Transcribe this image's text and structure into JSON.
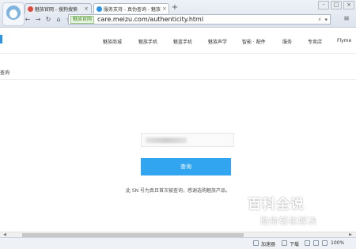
{
  "browser": {
    "tabs": [
      {
        "label": "魅族官网 - 搜狗搜索",
        "icon": "sogou-icon",
        "color": "#e04a3a"
      },
      {
        "label": "服务支持 - 真伪查询 - 魅族",
        "icon": "meizu-icon",
        "color": "#2a93e3"
      }
    ],
    "new_tab": "+",
    "window_buttons": [
      "-",
      "□",
      "×"
    ],
    "nav_buttons": [
      "←",
      "→",
      "↻",
      "⌂",
      "☆"
    ],
    "address": {
      "badge": "魅族官网",
      "url": "care.meizu.com/authenticity.html"
    },
    "address_right": [
      "⚡",
      "▾"
    ],
    "menu": "≡"
  },
  "site_nav": {
    "items": [
      "魅族商城",
      "魅族手机",
      "魅蓝手机",
      "魅族声学",
      "智能 · 配件",
      "服务",
      "专卖店",
      "Flyme"
    ]
  },
  "breadcrumb": {
    "text": "查询"
  },
  "form": {
    "query_button": "查询",
    "result_message": "此 SN 号为真且首次被查询，感谢选购魅族产品。"
  },
  "status_bar": {
    "accelerator": "加速器",
    "download": "下载",
    "zoom": "100%"
  },
  "watermark": {
    "title": "百科全说",
    "subtitle": "助你轻松解决"
  },
  "colors": {
    "accent": "#31a5ef",
    "brand": "#2a93e3"
  }
}
